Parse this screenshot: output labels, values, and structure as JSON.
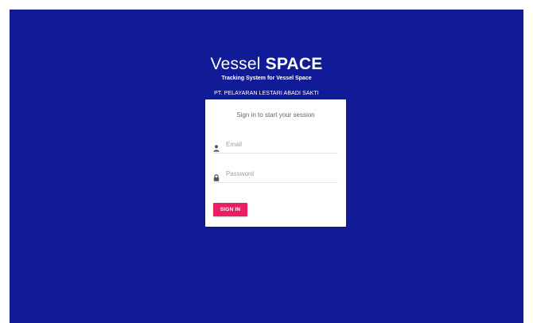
{
  "brand": {
    "title_light": "Vessel",
    "title_bold": "SPACE",
    "subtitle": "Tracking System for Vessel Space",
    "company": "PT. PELAYARAN LESTARI ABADI SAKTI"
  },
  "login": {
    "message": "Sign in to start your session",
    "email_placeholder": "Email",
    "password_placeholder": "Password",
    "signin_label": "SIGN IN"
  },
  "colors": {
    "background": "#121b97",
    "accent": "#ea1e63",
    "card": "#ffffff"
  },
  "icons": {
    "email": "person-icon",
    "password": "lock-icon"
  }
}
